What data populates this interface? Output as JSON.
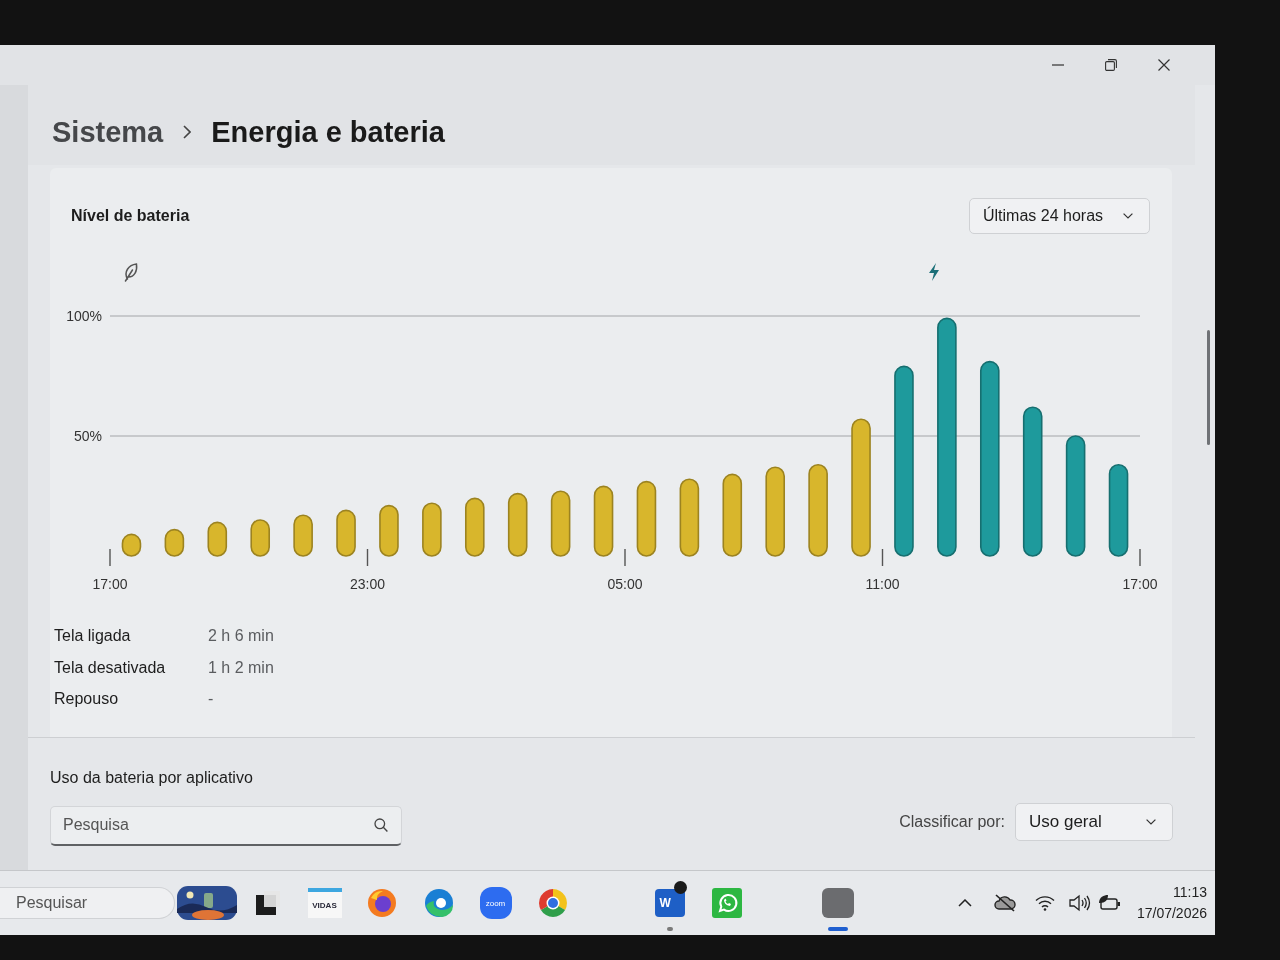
{
  "breadcrumb": [
    "Sistema",
    "Energia e bateria"
  ],
  "battery_level": {
    "title": "Nível de bateria",
    "range": "Últimas 24 horas",
    "chart_data": {
      "type": "bar",
      "categories": [
        "17:00",
        null,
        null,
        null,
        null,
        null,
        "23:00",
        null,
        null,
        null,
        null,
        null,
        "05:00",
        null,
        null,
        null,
        null,
        null,
        "11:00",
        null,
        null,
        null,
        null,
        null,
        "17:00"
      ],
      "ylim": [
        0,
        100
      ],
      "yticks": [
        {
          "value": 50,
          "label": "50%"
        },
        {
          "value": 100,
          "label": "100%"
        }
      ],
      "series": [
        {
          "color": "#d8b62c",
          "values": [
            9,
            11,
            14,
            15,
            17,
            19,
            21,
            22,
            24,
            26,
            27,
            29,
            31,
            32,
            34,
            37,
            38,
            57,
            null,
            null,
            null,
            null,
            null,
            null,
            null
          ]
        },
        {
          "color": "#1e9a9c",
          "values": [
            null,
            null,
            null,
            null,
            null,
            null,
            null,
            null,
            null,
            null,
            null,
            null,
            null,
            null,
            null,
            null,
            null,
            null,
            79,
            99,
            81,
            62,
            50,
            38,
            null
          ]
        }
      ]
    },
    "stats": [
      {
        "label": "Tela ligada",
        "value": "2 h 6 min"
      },
      {
        "label": "Tela desativada",
        "value": "1 h 2 min"
      },
      {
        "label": "Repouso",
        "value": "-"
      }
    ]
  },
  "app_usage": {
    "title": "Uso da bateria por aplicativo",
    "search": {
      "placeholder": "Pesquisa"
    },
    "sort_label": "Classificar por:",
    "sort_value": "Uso geral"
  },
  "taskbar": {
    "search": {
      "placeholder": "Pesquisar"
    },
    "apps": [
      {
        "kind": "widget",
        "running": false,
        "active": false,
        "badge": false
      },
      {
        "kind": "squares",
        "running": false,
        "active": false,
        "badge": false
      },
      {
        "kind": "text-tile",
        "label": "VIDAS",
        "running": false,
        "active": false,
        "badge": false
      },
      {
        "kind": "fox-globe",
        "running": false,
        "active": false,
        "badge": false
      },
      {
        "kind": "swirl",
        "running": false,
        "active": false,
        "badge": false
      },
      {
        "kind": "text-circle",
        "label": "zoom",
        "running": false,
        "active": false,
        "badge": false
      },
      {
        "kind": "tricolor",
        "running": false,
        "active": false,
        "badge": false
      },
      {
        "kind": "letter-tile",
        "label": "W",
        "running": true,
        "active": false,
        "badge": true
      },
      {
        "kind": "chat",
        "running": false,
        "active": false,
        "badge": false
      },
      {
        "kind": "plain",
        "running": true,
        "active": true,
        "badge": false
      }
    ],
    "clock": {
      "time": "11:13",
      "date": "17/07/2026"
    }
  }
}
